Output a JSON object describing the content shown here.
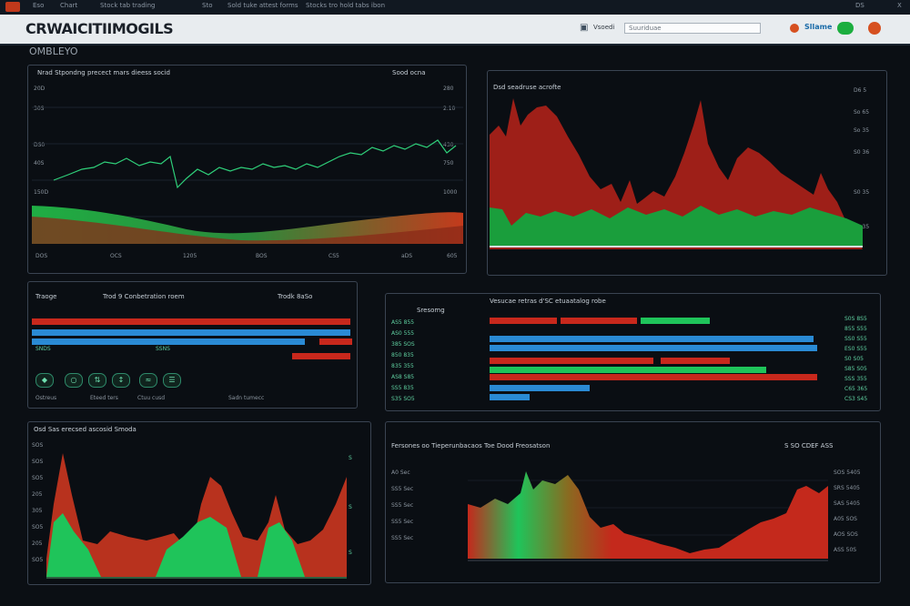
{
  "topbar": {
    "items": [
      "Eso",
      "Chart",
      "Stock tab trading",
      "Sto",
      "Sold tuke attest forms",
      "Stocks tro hold tabs ibon"
    ],
    "right": "DS",
    "close": "X"
  },
  "header": {
    "title": "CRWAICITIIMOGILS",
    "search_label": "Vsoedi",
    "search_placeholder": "Suuriduae",
    "share_label": "Sllame"
  },
  "subtitle": "OMBLEYO",
  "panel_tl": {
    "title": "Nrad Stpondng precect mars dieess socid",
    "right": "Sood ocna",
    "yleft": [
      "20D",
      "30S",
      "DS0",
      "40S",
      "150D"
    ],
    "yright": [
      "280",
      "2.10",
      "430",
      "750",
      "1000"
    ],
    "xticks": [
      "DOS",
      "OCS",
      "1205",
      "BOS",
      "CS5",
      "aDS",
      "605"
    ]
  },
  "panel_tr": {
    "title": "Dsd seadruse acrofte",
    "yright": [
      "D6 5",
      "So 65",
      "So 35",
      "S0 36",
      "S0 35",
      "S0 35"
    ]
  },
  "panel_ml": {
    "title": "Trod 9 Conbetration roem",
    "right": "Trodk 8aSo",
    "label1": "SNDS",
    "label2": "SSNS",
    "tag": "Traoge",
    "footer": [
      "Ostreus",
      "Eteed ters",
      "Ctuu cusd",
      "Sadn tumecc"
    ]
  },
  "panel_mr": {
    "title": "Vesucae retras d'SC etuaatalog robe",
    "left_header": "Sresomg",
    "left_rows": [
      "AS5  855",
      "AS0  555",
      "385  SOS",
      "850  835",
      "835  355",
      "AS8  S85",
      "SS5  835",
      "S35  SO5"
    ],
    "right_ticks": [
      "S0S 8S5",
      "855 S55",
      "SS0 S55",
      "ES0 S55",
      "S0 S05",
      "S85 S05",
      "SSS 355",
      "C65 365",
      "CS3 S45"
    ]
  },
  "panel_bl": {
    "title": "Osd Sas erecsed ascosid Smoda",
    "yleft": [
      "SOS",
      "SOS",
      "SO5",
      "205",
      "305",
      "SO5",
      "205",
      "SO5"
    ],
    "yright": [
      "S",
      "S",
      "S"
    ]
  },
  "panel_br": {
    "title": "Fersones oo Tieperunbacaos Toe Dood Freosatson",
    "right": "S SO CDEF ASS",
    "yleft": [
      "A0 Sec",
      "SS5 Sec",
      "SS5 Sec",
      "SS5 Sec",
      "SS5 Sec"
    ],
    "yright": [
      "SOS 5405",
      "SRS 5405",
      "SAS 5405",
      "A05 SOS",
      "AOS SOS",
      "ASS 50S"
    ]
  },
  "colors": {
    "green": "#1fae44",
    "red": "#c4291c",
    "blue": "#2a8ad4",
    "bg": "#0a0e13"
  }
}
